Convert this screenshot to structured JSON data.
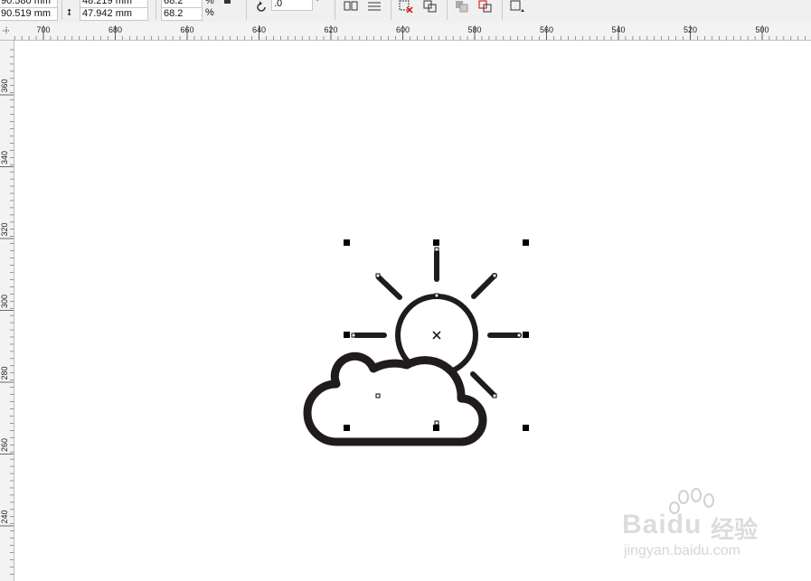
{
  "toolbar": {
    "x_value": "90.580 mm",
    "y_value": "90.519 mm",
    "width_value": "48.219 mm",
    "height_value": "47.942 mm",
    "scale_x_value": "68.2",
    "scale_y_value": "68.2",
    "percent_label": "%",
    "rotation_value": ".0",
    "degree_symbol": "°"
  },
  "ruler": {
    "horizontal_ticks": [
      "700",
      "680",
      "660",
      "640",
      "620",
      "600",
      "580",
      "560",
      "540",
      "520",
      "500"
    ],
    "vertical_ticks": [
      "360",
      "340",
      "320",
      "300",
      "280",
      "260",
      "240"
    ]
  },
  "watermark": {
    "brand": "Baidu",
    "product": "经验",
    "url": "jingyan.baidu.com"
  },
  "colors": {
    "icon_stroke": "#1f1c1b",
    "ruler_bg": "#f3f3f3",
    "toolbar_bg": "#f0f0f0"
  }
}
